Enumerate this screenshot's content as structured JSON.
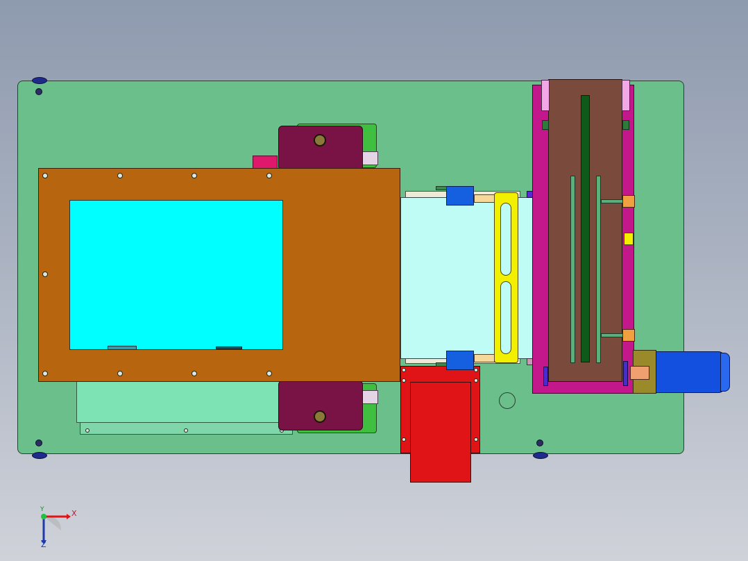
{
  "view": {
    "title": "",
    "triad": {
      "x_label": "X",
      "y_label": "Y",
      "z_label": "Z"
    }
  },
  "colors": {
    "background_top": "#8e9aae",
    "background_bottom": "#cfd2d9",
    "base_plate": "#6abf8b",
    "frame": "#b8650f",
    "window": "#00ffff",
    "maroon_block": "#7a1345",
    "conveyor_belt": "#c0fcf6",
    "yellow_bracket": "#f2f000",
    "red_chute": "#e01317",
    "magenta_frame": "#c2188c",
    "brown_panel": "#7a4a3c",
    "motor": "#1450e0"
  },
  "icons": [
    "axis-triad-icon"
  ]
}
